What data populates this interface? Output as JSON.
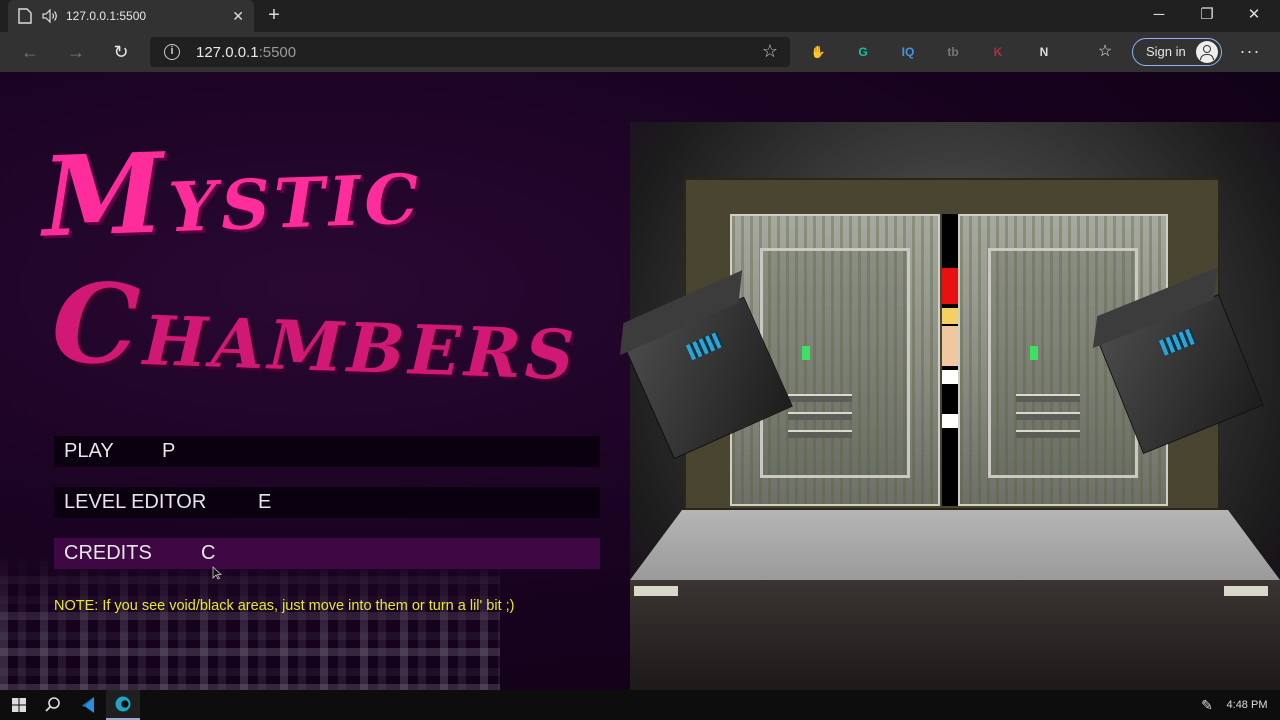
{
  "browser": {
    "tab_title": "127.0.0.1:5500",
    "address": {
      "host": "127.0.0.1",
      "port": ":5500"
    },
    "sign_in_label": "Sign in",
    "extensions": [
      {
        "name": "adblock-icon",
        "label": "✋",
        "color": "#e0242a"
      },
      {
        "name": "grammarly-icon",
        "label": "G",
        "color": "#15c39a"
      },
      {
        "name": "iq-icon",
        "label": "IQ",
        "color": "#4a90e2"
      },
      {
        "name": "tb-icon",
        "label": "tb",
        "color": "#777777"
      },
      {
        "name": "k-icon",
        "label": "K",
        "color": "#b0303a"
      },
      {
        "name": "notion-icon",
        "label": "N",
        "color": "#dddddd"
      }
    ]
  },
  "page": {
    "title_line1": {
      "cap": "M",
      "rest": "YSTIC"
    },
    "title_line2": {
      "cap": "C",
      "rest": "HAMBERS"
    },
    "menu": [
      {
        "label": "PLAY",
        "key": "P"
      },
      {
        "label": "LEVEL EDITOR",
        "key": "E"
      },
      {
        "label": "CREDITS",
        "key": "C"
      }
    ],
    "note": "NOTE: If you see void/black areas, just move into them or turn a lil' bit ;)",
    "colors": {
      "title1": "#ff2d9b",
      "title2": "#d01874",
      "note": "#e8e830",
      "selected": "#3d0843"
    }
  },
  "taskbar": {
    "time": "4:48 PM"
  }
}
